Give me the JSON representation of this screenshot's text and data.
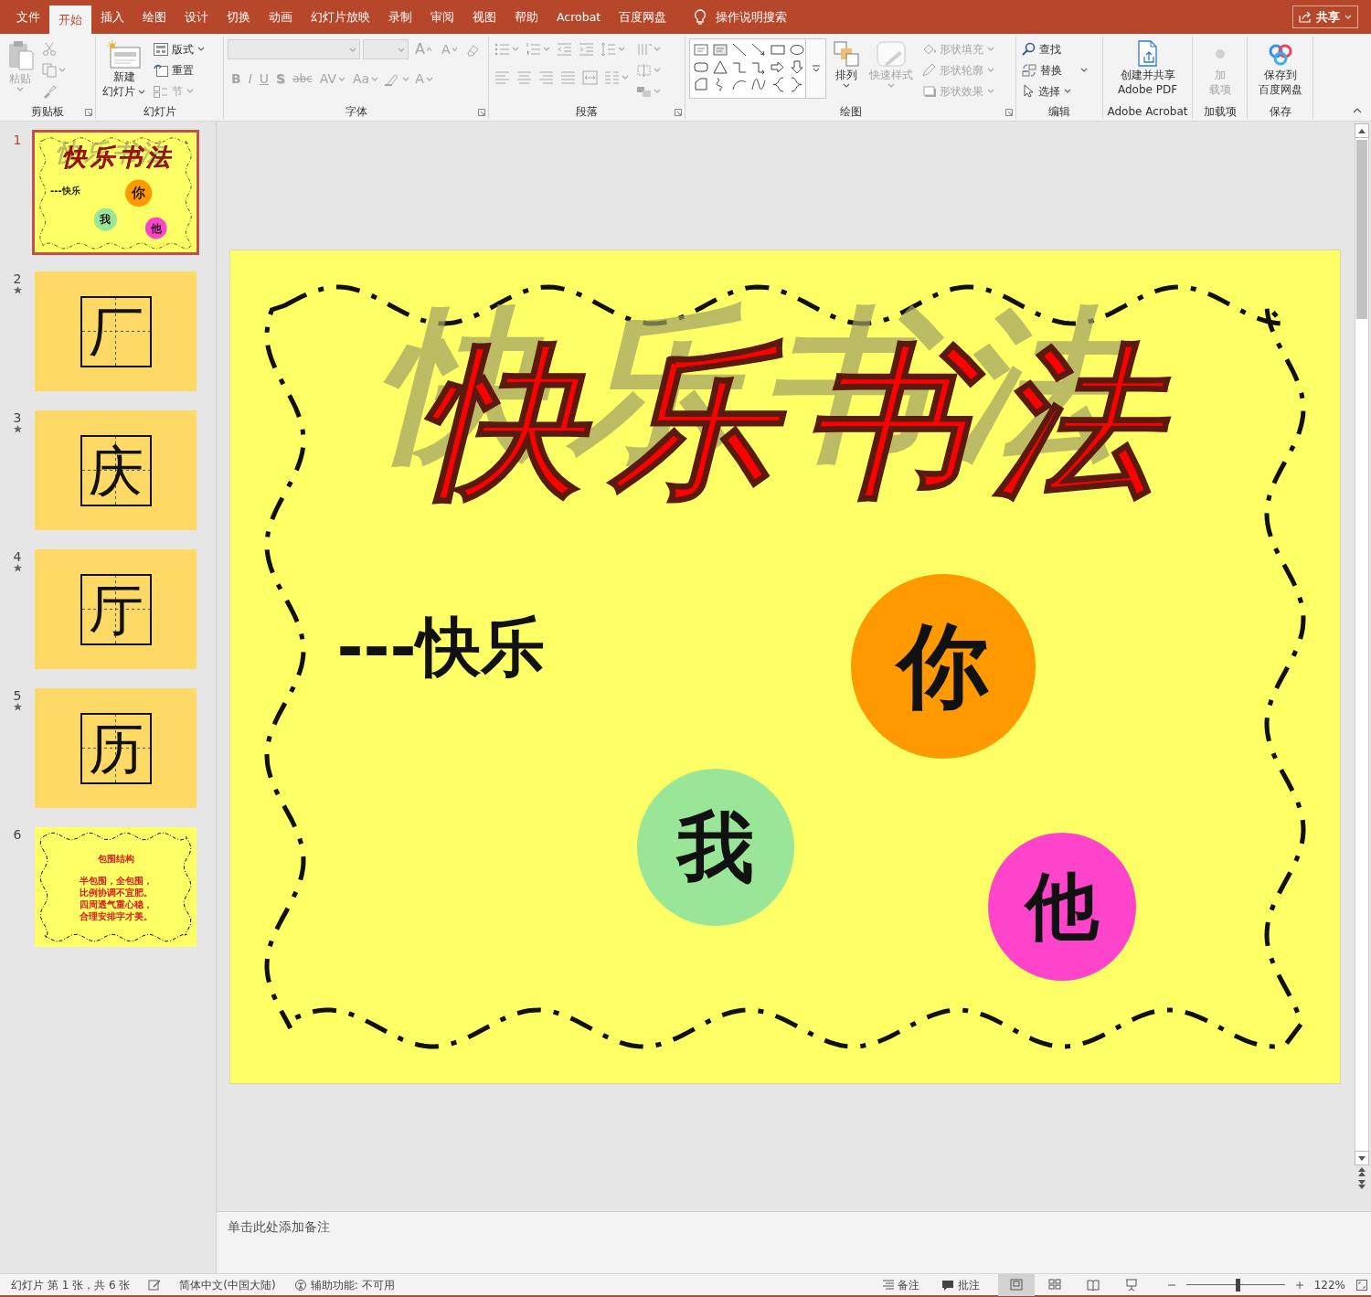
{
  "tabs": [
    {
      "label": "文件",
      "selected": false
    },
    {
      "label": "开始",
      "selected": true
    },
    {
      "label": "插入",
      "selected": false
    },
    {
      "label": "绘图",
      "selected": false
    },
    {
      "label": "设计",
      "selected": false
    },
    {
      "label": "切换",
      "selected": false
    },
    {
      "label": "动画",
      "selected": false
    },
    {
      "label": "幻灯片放映",
      "selected": false
    },
    {
      "label": "录制",
      "selected": false
    },
    {
      "label": "审阅",
      "selected": false
    },
    {
      "label": "视图",
      "selected": false
    },
    {
      "label": "帮助",
      "selected": false
    },
    {
      "label": "Acrobat",
      "selected": false
    },
    {
      "label": "百度网盘",
      "selected": false
    }
  ],
  "tell_me": "操作说明搜索",
  "share_button": "共享",
  "ribbon": {
    "clipboard": {
      "title": "剪贴板",
      "paste": {
        "label": "粘贴",
        "disabled": true
      }
    },
    "slides": {
      "title": "幻灯片",
      "new_slide": [
        "新建",
        "幻灯片"
      ],
      "layout": "版式",
      "reset": "重置",
      "section": {
        "label": "节",
        "disabled": true
      }
    },
    "font": {
      "title": "字体",
      "row1": [
        {
          "label": "A",
          "disabled": true
        },
        {
          "label": "A",
          "disabled": true
        }
      ],
      "row2": [
        {
          "label": "B",
          "disabled": true
        },
        {
          "label": "I",
          "disabled": true
        },
        {
          "label": "U",
          "disabled": true
        },
        {
          "label": "S",
          "disabled": true
        },
        {
          "label": "abc",
          "disabled": true
        },
        {
          "label": "AV",
          "disabled": true
        },
        {
          "label": "Aa",
          "disabled": true
        },
        {
          "label": "A",
          "disabled": true
        }
      ]
    },
    "paragraph": {
      "title": "段落"
    },
    "drawing": {
      "title": "绘图",
      "arrange": "排列",
      "quick_styles": {
        "label": "快速样式",
        "disabled": true
      },
      "shape_menus": [
        {
          "label": "形状填充",
          "disabled": true
        },
        {
          "label": "形状轮廓",
          "disabled": true
        },
        {
          "label": "形状效果",
          "disabled": true
        }
      ]
    },
    "editing": {
      "title": "编辑",
      "find": "查找",
      "replace": "替换",
      "select": "选择"
    },
    "acrobat": {
      "title": "Adobe Acrobat",
      "create": [
        "创建并共享",
        "Adobe PDF"
      ]
    },
    "addins": {
      "title": "加载项",
      "button": {
        "label": [
          "加",
          "载项"
        ],
        "disabled": true
      }
    },
    "save": {
      "title": "保存",
      "button": [
        "保存到",
        "百度网盘"
      ]
    }
  },
  "slides": [
    {
      "number": "1",
      "kind": "title",
      "selected": true,
      "animated": false,
      "content": {
        "title": "快乐书法",
        "subtitle": "---快乐",
        "circles": [
          {
            "text": "你",
            "color": "#ff9900"
          },
          {
            "text": "我",
            "color": "#99e699"
          },
          {
            "text": "他",
            "color": "#ff44cc"
          }
        ]
      }
    },
    {
      "number": "2",
      "kind": "character",
      "selected": false,
      "animated": true,
      "character": "厂"
    },
    {
      "number": "3",
      "kind": "character",
      "selected": false,
      "animated": true,
      "character": "庆"
    },
    {
      "number": "4",
      "kind": "character",
      "selected": false,
      "animated": true,
      "character": "厅"
    },
    {
      "number": "5",
      "kind": "character",
      "selected": false,
      "animated": true,
      "character": "历"
    },
    {
      "number": "6",
      "kind": "verse",
      "selected": false,
      "animated": false,
      "heading": "包围结构",
      "lines": [
        "半包围，全包围，",
        "比例协调**不宜肥**。",
        "四周透气重心稳，",
        "合理安排字才美。"
      ]
    }
  ],
  "current_slide": {
    "title": "快乐书法",
    "subtitle": "---快乐",
    "circles": [
      {
        "text": "你",
        "color": "#ff9900"
      },
      {
        "text": "我",
        "color": "#99e699"
      },
      {
        "text": "他",
        "color": "#ff44cc"
      }
    ]
  },
  "notes": {
    "placeholder": "单击此处添加备注"
  },
  "status_bar": {
    "slide_info": "幻灯片 第 1 张，共 6 张",
    "language": "简体中文(中国大陆)",
    "accessibility": "辅助功能: 不可用",
    "notes": "备注",
    "comments": "批注",
    "views": [
      {
        "selected": true
      },
      {
        "selected": false
      },
      {
        "selected": false
      },
      {
        "selected": false
      }
    ],
    "zoom": {
      "level": 0.52,
      "reading": "122%"
    }
  }
}
